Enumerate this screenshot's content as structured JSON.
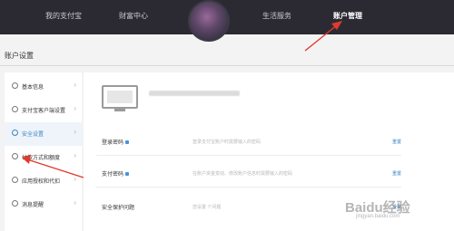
{
  "nav": {
    "items": [
      "我的支付宝",
      "财富中心",
      "生活服务",
      "账户管理"
    ],
    "active": "账户管理"
  },
  "page": {
    "title": "账户设置"
  },
  "sidebar": {
    "items": [
      {
        "label": "基本信息",
        "icon": "user-icon"
      },
      {
        "label": "支付宝客户端设置",
        "icon": "phone-icon"
      },
      {
        "label": "安全设置",
        "icon": "shield-icon"
      },
      {
        "label": "付款方式和额度",
        "icon": "yen-icon"
      },
      {
        "label": "应用授权和代扣",
        "icon": "link-icon"
      },
      {
        "label": "消息提醒",
        "icon": "bell-icon"
      }
    ],
    "active_index": 2
  },
  "security": {
    "rows": [
      {
        "label": "登录密码",
        "desc": "登录支付宝账户时需要输入的密码",
        "action": "重置",
        "locked": true
      },
      {
        "label": "支付密码",
        "desc": "在账户资金变动、修改账户信息时需要输入的密码",
        "action": "重置",
        "locked": true
      },
      {
        "label": "安全保护问题",
        "desc": "您设置       个问题",
        "action": "设置",
        "locked": false
      }
    ]
  },
  "watermark": {
    "text": "Baidu经验",
    "url": "jingyan.baidu.com"
  },
  "colors": {
    "nav_bg": "#2b2a33",
    "accent": "#3d83c6",
    "annotation": "#e03a2e"
  }
}
